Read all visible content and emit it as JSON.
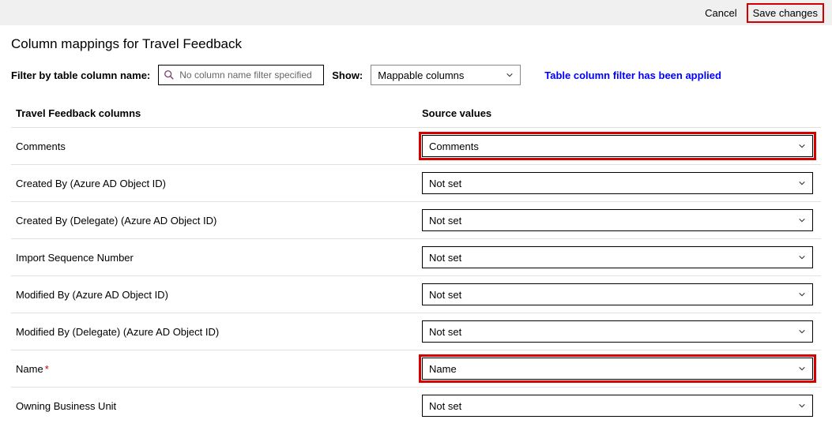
{
  "topbar": {
    "cancel_label": "Cancel",
    "save_label": "Save changes"
  },
  "page": {
    "title": "Column mappings for Travel Feedback"
  },
  "filter": {
    "label": "Filter by table column name:",
    "placeholder": "No column name filter specified",
    "show_label": "Show:",
    "show_value": "Mappable columns",
    "status_text": "Table column filter has been applied"
  },
  "headers": {
    "left": "Travel Feedback columns",
    "right": "Source values"
  },
  "rows": [
    {
      "label": "Comments",
      "value": "Comments",
      "required": false,
      "highlight": true
    },
    {
      "label": "Created By (Azure AD Object ID)",
      "value": "Not set",
      "required": false,
      "highlight": false
    },
    {
      "label": "Created By (Delegate) (Azure AD Object ID)",
      "value": "Not set",
      "required": false,
      "highlight": false
    },
    {
      "label": "Import Sequence Number",
      "value": "Not set",
      "required": false,
      "highlight": false
    },
    {
      "label": "Modified By (Azure AD Object ID)",
      "value": "Not set",
      "required": false,
      "highlight": false
    },
    {
      "label": "Modified By (Delegate) (Azure AD Object ID)",
      "value": "Not set",
      "required": false,
      "highlight": false
    },
    {
      "label": "Name",
      "value": "Name",
      "required": true,
      "highlight": true
    },
    {
      "label": "Owning Business Unit",
      "value": "Not set",
      "required": false,
      "highlight": false
    }
  ]
}
